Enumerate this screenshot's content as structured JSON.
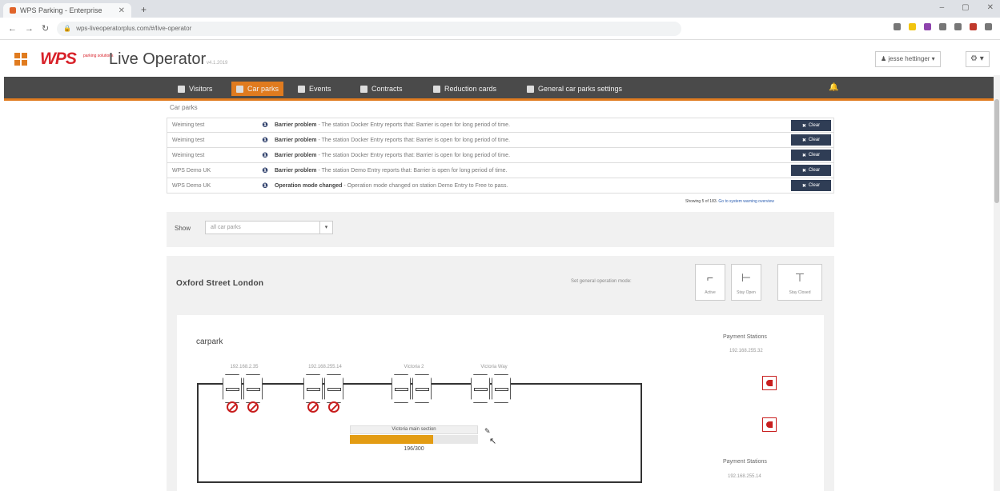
{
  "browser": {
    "tab_title": "WPS Parking - Enterprise",
    "new_tab": "+",
    "url": "wps-liveoperatorplus.com/#/live-operator",
    "window_controls": [
      "–",
      "▢",
      "✕"
    ],
    "ext_colors": [
      "#777777",
      "#f1c40f",
      "#8e44ad",
      "#777777",
      "#777777",
      "#c0392b",
      "#777777"
    ]
  },
  "header": {
    "brand": "WPS",
    "brand_sub": "parking solutions",
    "title": "Live Operator",
    "version": "v4.1.2019",
    "user": "jesse hettinger ▾",
    "gear": "⚙ ▾"
  },
  "nav": {
    "items": [
      {
        "label": "Visitors",
        "active": false
      },
      {
        "label": "Car parks",
        "active": true
      },
      {
        "label": "Events",
        "active": false
      },
      {
        "label": "Contracts",
        "active": false
      },
      {
        "label": "Reduction cards",
        "active": false
      },
      {
        "label": "General car parks settings",
        "active": false
      }
    ]
  },
  "alerts": {
    "section_label": "Car parks",
    "clear_label": "Clear",
    "rows": [
      {
        "park": "Weiming test",
        "title": "Barrier problem",
        "text": " - The station Docker Entry reports that: Barrier is open for long period of time."
      },
      {
        "park": "Weiming test",
        "title": "Barrier problem",
        "text": " - The station Docker Entry reports that: Barrier is open for long period of time."
      },
      {
        "park": "Weiming test",
        "title": "Barrier problem",
        "text": " - The station Docker Entry reports that: Barrier is open for long period of time."
      },
      {
        "park": "WPS Demo UK",
        "title": "Barrier problem",
        "text": " - The station Demo Entry reports that: Barrier is open for long period of time."
      },
      {
        "park": "WPS Demo UK",
        "title": "Operation mode changed",
        "text": " - Operation mode changed on station Demo Entry to Free to pass."
      }
    ],
    "showing": "Showing 5 of 183.",
    "showing_link": "Go to system warning overview"
  },
  "filter": {
    "show_label": "Show",
    "select_value": "all car parks"
  },
  "carpark": {
    "name": "Oxford Street London",
    "op_mode_label": "Set general operation mode:",
    "op_buttons": [
      "Active",
      "Stay Open",
      "Stay Closed"
    ],
    "title": "carpark",
    "lanes": [
      "192.168.2.35",
      "192.168.255.14",
      "Victoria 2",
      "Victoria Way"
    ],
    "section": {
      "name": "Victoria main section",
      "count": "196/300",
      "fill": 0.65
    },
    "payment_title": "Payment Stations",
    "payment_ip": "192.168.255.32",
    "payment_title2": "Payment Stations",
    "payment_ip2": "192.168.255.14"
  }
}
